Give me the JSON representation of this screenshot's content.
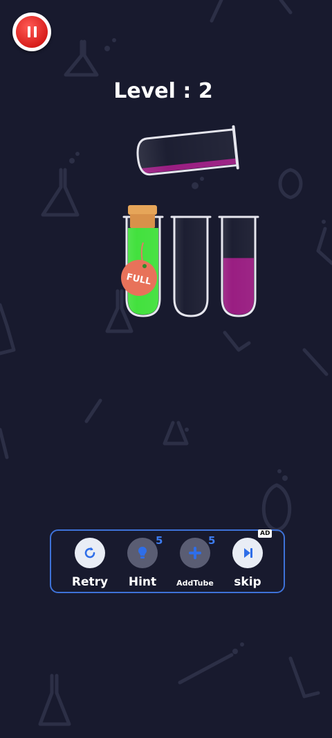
{
  "header": {
    "level_text": "Level : 2"
  },
  "tubes": {
    "tilted": {
      "liquid": "purple",
      "fill_fraction": 0.2
    },
    "items": [
      {
        "liquid": "green",
        "fill_fraction": 1.0,
        "corked": true,
        "label": "FULL"
      },
      {
        "liquid": "none",
        "fill_fraction": 0.0,
        "corked": false
      },
      {
        "liquid": "purple",
        "fill_fraction": 0.6,
        "corked": false
      }
    ]
  },
  "toolbar": {
    "retry": {
      "label": "Retry",
      "icon": "refresh-icon"
    },
    "hint": {
      "label": "Hint",
      "count": "5",
      "icon": "bulb-icon"
    },
    "addtube": {
      "label": "AddTube",
      "count": "5",
      "icon": "plus-icon"
    },
    "skip": {
      "label": "skip",
      "badge": "AD",
      "icon": "skip-icon"
    }
  },
  "colors": {
    "background": "#181a2e",
    "green_liquid": "#3fe03a",
    "purple_liquid": "#97197f",
    "pause_red": "#d81f1c",
    "toolbar_border": "#3e72d8",
    "count_blue": "#3d7cf0",
    "full_tag": "#e8725a"
  }
}
